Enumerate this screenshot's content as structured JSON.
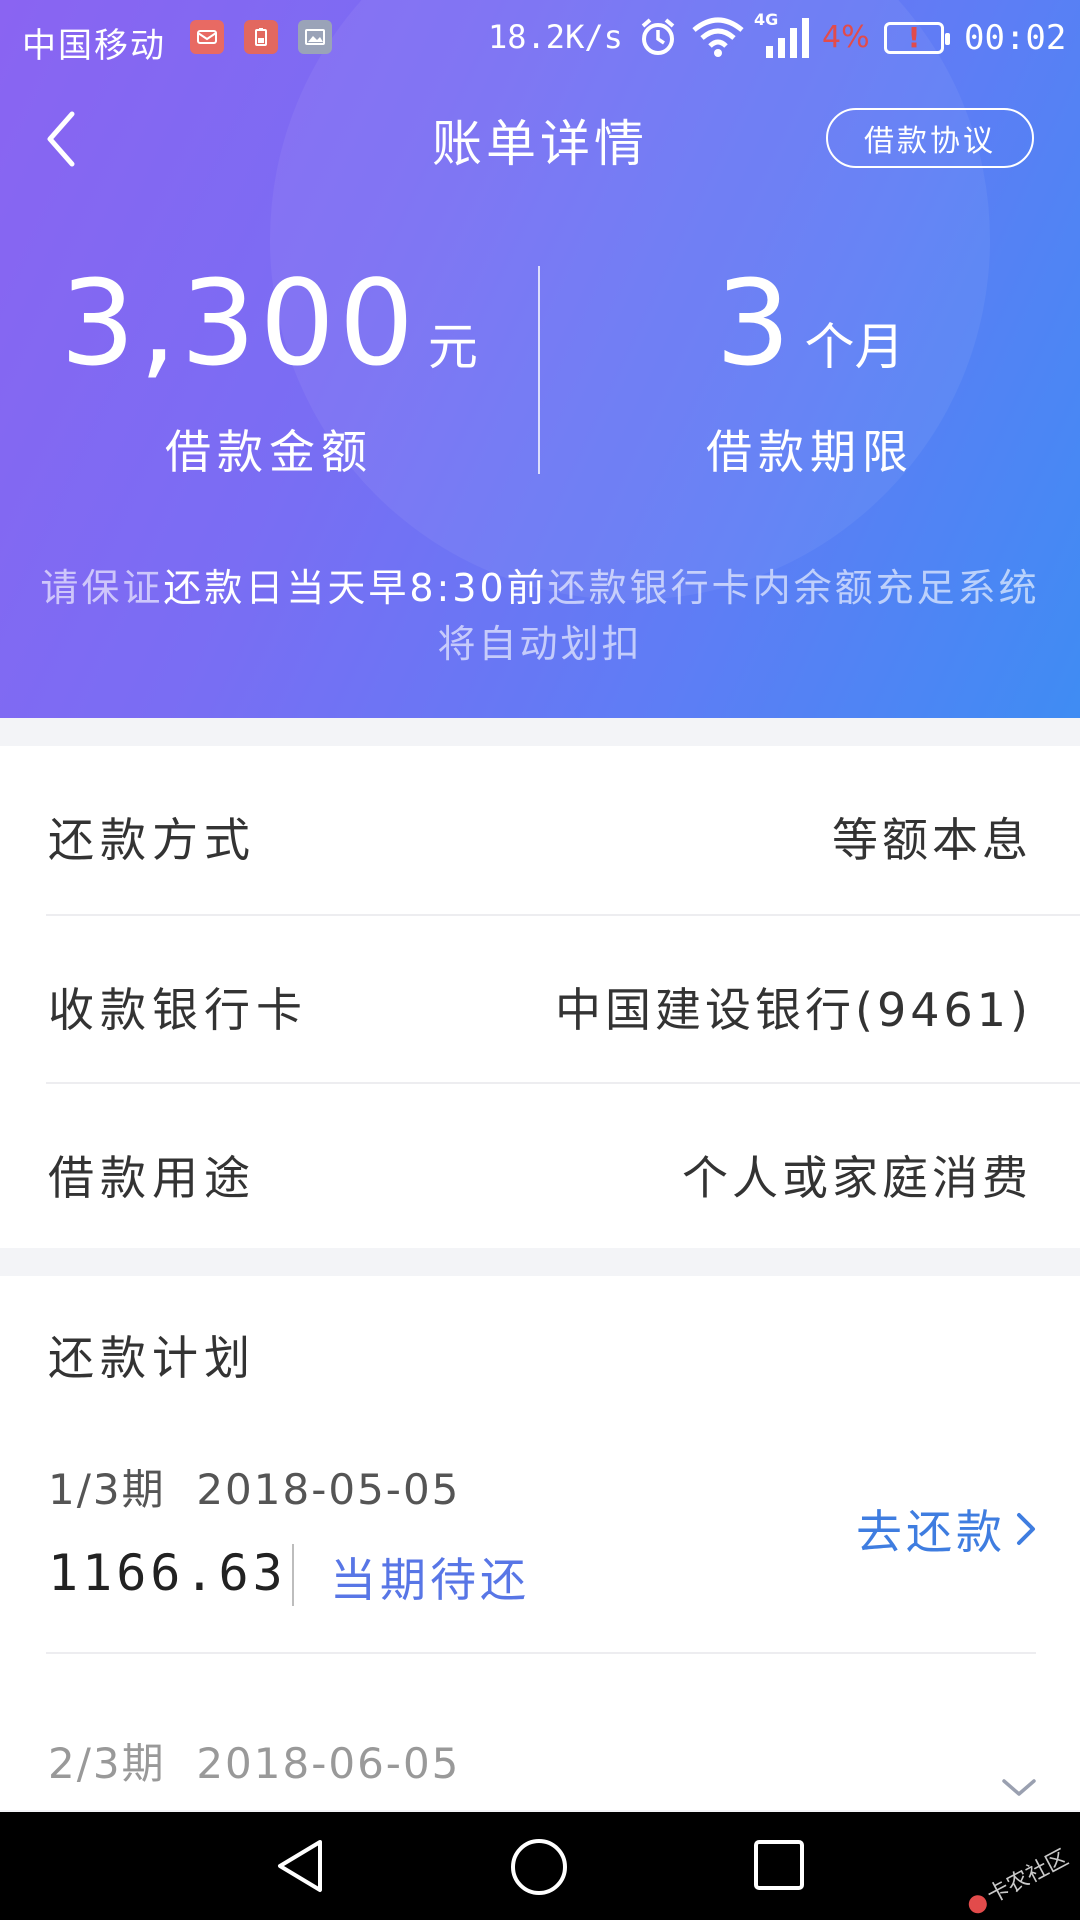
{
  "status_bar": {
    "carrier": "中国移动",
    "network_speed": "18.2K/s",
    "network_type": "4G",
    "battery_percent": "4%",
    "battery_alert": "!",
    "time": "00:02",
    "icons": [
      "mail-icon",
      "battery-tip-icon",
      "gallery-icon",
      "alarm-icon",
      "wifi-icon",
      "signal-icon",
      "battery-icon"
    ]
  },
  "header": {
    "title": "账单详情",
    "agreement_button": "借款协议",
    "back_icon": "chevron-left-icon"
  },
  "summary": {
    "amount_value": "3,300",
    "amount_unit": "元",
    "amount_caption": "借款金额",
    "term_value": "3",
    "term_unit": "个月",
    "term_caption": "借款期限"
  },
  "notice": {
    "part1": "请保证",
    "part2": "还款日当天早8:30前",
    "part3": "还款银行卡内余额充足系统将自动划扣"
  },
  "details": [
    {
      "label": "还款方式",
      "value": "等额本息"
    },
    {
      "label": "收款银行卡",
      "value": "中国建设银行(9461)"
    },
    {
      "label": "借款用途",
      "value": "个人或家庭消费"
    }
  ],
  "plan": {
    "title": "还款计划",
    "items": [
      {
        "period": "1/3期",
        "date": "2018-05-05",
        "amount": "1166.63",
        "status": "当期待还",
        "action": "去还款"
      },
      {
        "period": "2/3期",
        "date": "2018-06-05"
      }
    ]
  },
  "watermark": "卡农社区",
  "colors": {
    "gradient_start": "#8a64f2",
    "gradient_end": "#3f8cf3",
    "status_blue": "#5876e6",
    "action_blue": "#3f7de0",
    "alert_red": "#e24b4b"
  }
}
